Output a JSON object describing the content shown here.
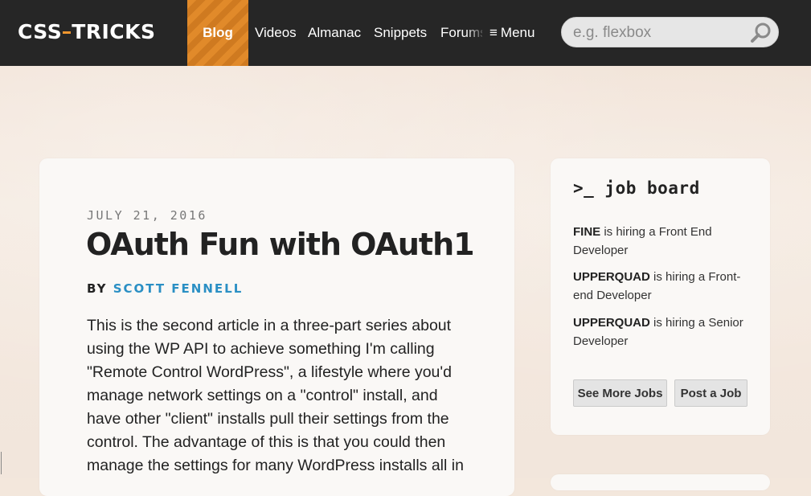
{
  "header": {
    "logo_text_left": "CSS",
    "logo_text_right": "TRICKS",
    "nav": [
      {
        "label": "Blog",
        "active": true
      },
      {
        "label": "Videos"
      },
      {
        "label": "Almanac"
      },
      {
        "label": "Snippets"
      },
      {
        "label": "Forums"
      }
    ],
    "menu_icon": "≡",
    "menu_label": "Menu",
    "search": {
      "placeholder": "e.g. flexbox",
      "value": "",
      "icon": "search-icon"
    }
  },
  "article": {
    "date": "JULY 21, 2016",
    "title": "OAuth Fun with OAuth1",
    "byline_prefix": "BY",
    "author": "SCOTT FENNELL",
    "body": "This is the second article in a three-part series about using the WP API to achieve something I'm calling \"Remote Control WordPress\", a lifestyle where you'd manage network settings on a \"control\" install, and have other \"client\" installs pull their settings from the control. The advantage of this is that you could then manage the settings for many WordPress installs all in"
  },
  "job_board": {
    "title": ">_ job board",
    "jobs": [
      {
        "company": "FINE",
        "text": " is hiring a Front End Developer"
      },
      {
        "company": "UPPERQUAD",
        "text": " is hiring a Front-end Developer"
      },
      {
        "company": "UPPERQUAD",
        "text": " is hiring a Senior Developer"
      }
    ],
    "see_more_label": "See More Jobs",
    "post_label": "Post a Job"
  },
  "colors": {
    "accent": "#e18a2a",
    "link": "#2a8fc4",
    "topbar": "#262626"
  }
}
